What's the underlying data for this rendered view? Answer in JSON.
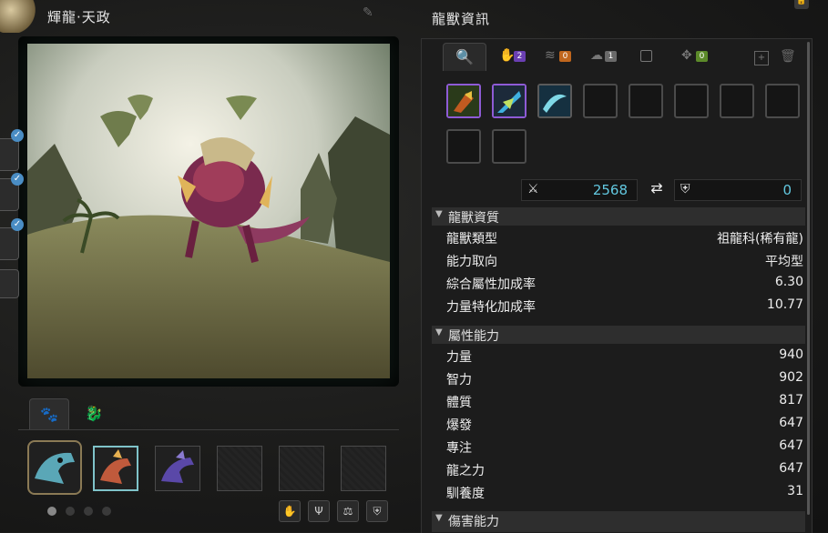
{
  "left_panel": {
    "title": "輝龍·天政"
  },
  "right_panel": {
    "title": "龍獸資訊"
  },
  "tabs": {
    "badges": [
      "2",
      "0",
      "1",
      "0"
    ],
    "badge_colors": [
      "#6a3fb3",
      "#c0661d",
      "#6a6a6a",
      "#5c8a2a"
    ]
  },
  "stats": {
    "attack": "2568",
    "defense": "0"
  },
  "quality_section": {
    "title": "龍獸資質",
    "rows": [
      {
        "label": "龍獸類型",
        "value": "祖龍科(稀有龍)"
      },
      {
        "label": "能力取向",
        "value": "平均型"
      },
      {
        "label": "綜合屬性加成率",
        "value": "6.30"
      },
      {
        "label": "力量特化加成率",
        "value": "10.77"
      }
    ]
  },
  "attribute_section": {
    "title": "屬性能力",
    "rows": [
      {
        "label": "力量",
        "value": "940"
      },
      {
        "label": "智力",
        "value": "902"
      },
      {
        "label": "體質",
        "value": "817"
      },
      {
        "label": "爆發",
        "value": "647"
      },
      {
        "label": "專注",
        "value": "647"
      },
      {
        "label": "龍之力",
        "value": "647"
      },
      {
        "label": "馴養度",
        "value": "31"
      }
    ]
  },
  "damage_section": {
    "title": "傷害能力"
  },
  "icons": [
    "brush-icon",
    "lock-icon",
    "paw-icon",
    "dragon-icon",
    "search-icon",
    "claw-icon",
    "wing-icon",
    "crossed-swords-icon",
    "swap-icon",
    "armor-icon",
    "trash-icon",
    "add-icon",
    "balance-icon",
    "check-icon"
  ]
}
